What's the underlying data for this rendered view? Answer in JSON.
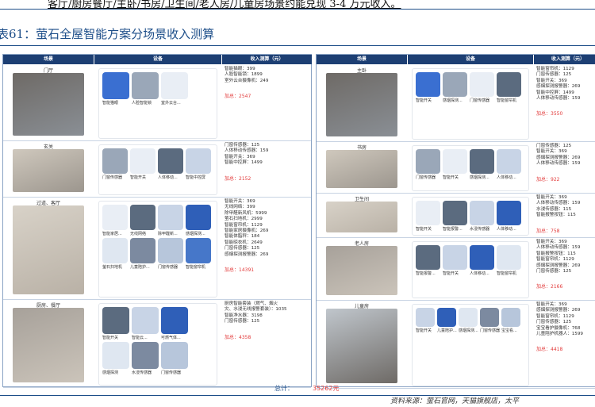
{
  "top_line": "客厅/厨房餐厅/主卧/书房/卫生间/老人房/儿童房场景约能兑现 3-4 万元收入。",
  "figure_title": "表61：萤石全屋智能方案分场景收入测算",
  "headers": {
    "scene": "场景",
    "device": "设备",
    "income": "收入测算（元）"
  },
  "left_rows": [
    {
      "scene": "门厅",
      "items": [
        "智能猫眼：399",
        "人脸智能锁：1899",
        "室外云台摄像机：249"
      ],
      "sum": "加总：2547",
      "devices": [
        "智能猫眼",
        "人脸智能锁",
        "室外云台..."
      ]
    },
    {
      "scene": "玄关",
      "items": [
        "门窗传感器：125",
        "人体移动传感器：159",
        "智能开关：369",
        "智能中控屏：1499"
      ],
      "sum": "加总：2152",
      "devices": [
        "门窗传感器",
        "智能开关",
        "人体移动...",
        "智能中控屏"
      ]
    },
    {
      "scene": "过道、客厅",
      "items": [
        "智能开关：369",
        "无线网络：399",
        "除甲醛新风机：5999",
        "萤石扫地机：2999",
        "智能窗帘机：1129",
        "智能家居摄像机：269",
        "智能体脂秤：184",
        "智能晾衣机：2649",
        "门窗传感器：125",
        "感烟探测报警器：269"
      ],
      "sum": "加总：14391",
      "devices": [
        "智能家居...",
        "无线网络",
        "除甲醛新...",
        "感烟探测...",
        "萤石扫地机",
        "儿童陪护...",
        "门窗传感器",
        "智能窗帘机",
        "智能晾衣机",
        "智能体脂秤"
      ]
    },
    {
      "scene": "厨房、餐厅",
      "items": [
        "厨房智能套装（燃气、烟火",
        "灾、水浸无线报警套装）：1035",
        "智能净水器：3198",
        "门窗传感器：125"
      ],
      "sum": "加总：4358",
      "devices": [
        "智能开关",
        "智能云...",
        "可燃气体...",
        "感烟探测",
        "水浸传感器",
        "门窗传感器",
        "智能净水器"
      ]
    }
  ],
  "right_rows": [
    {
      "scene": "主卧",
      "items": [
        "智能窗帘机：1129",
        "门窗传感器：125",
        "智能开关：369",
        "感烟探测报警器：269",
        "智能中控屏：1499",
        "人体移动传感器：159"
      ],
      "sum": "加总：3550",
      "devices": [
        "智能开关",
        "感烟探测...",
        "门窗传感器",
        "智能窗帘机"
      ]
    },
    {
      "scene": "书房",
      "items": [
        "门窗传感器：125",
        "智能开关：369",
        "感烟探测报警器：269",
        "人体移动传感器：159"
      ],
      "sum": "加总：922",
      "devices": [
        "门窗传感器",
        "智能开关",
        "感烟探测...",
        "人体移动..."
      ]
    },
    {
      "scene": "卫生间",
      "items": [
        "智能开关：369",
        "人体移动传感器：159",
        "水浸传感器：115",
        "智能报警按钮：115"
      ],
      "sum": "加总：758",
      "devices": [
        "智能开关",
        "智能报警...",
        "水浸传感器",
        "人体移动..."
      ]
    },
    {
      "scene": "老人房",
      "items": [
        "智能开关：369",
        "人体移动传感器：159",
        "智能报警按钮：115",
        "智能窗帘机：1129",
        "感烟探测报警器：269",
        "门窗传感器：125"
      ],
      "sum": "加总：2166",
      "devices": [
        "智能报警...",
        "智能开关",
        "人体移动...",
        "智能窗帘机"
      ]
    },
    {
      "scene": "儿童房",
      "items": [
        "智能开关：369",
        "感烟探测报警器：269",
        "智能窗帘机：1129",
        "门窗传感器：125",
        "宝宝看护摄像机：768",
        "儿童陪护机器人：1599"
      ],
      "sum": "加总：4418",
      "devices": [
        "智能开关",
        "儿童陪护...",
        "感烟探测...",
        "门窗传感器",
        "宝宝看..."
      ]
    }
  ],
  "total_label": "总计：",
  "total_value": "35262元",
  "source": "资料来源：萤石官网，天猫旗舰店，太平"
}
